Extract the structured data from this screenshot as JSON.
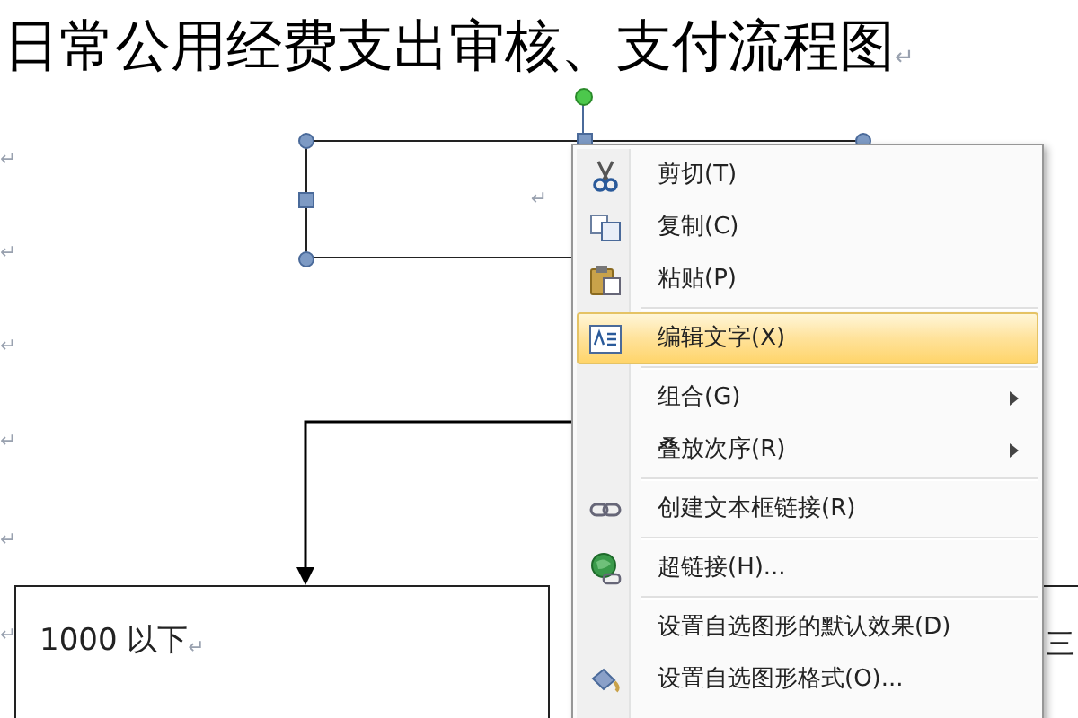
{
  "document": {
    "title": "日常公用经费支出审核、支付流程图",
    "title_mark": "↵",
    "paragraph_marks": [
      "↵",
      "↵",
      "↵",
      "↵",
      "↵",
      "↵"
    ],
    "selected_shape": {
      "mark": "↵"
    },
    "lower_box": {
      "text": "1000 以下",
      "mark": "↵"
    },
    "right_box": {
      "text": "三"
    }
  },
  "context_menu": {
    "items": [
      {
        "kind": "item",
        "label": "剪切(T)",
        "highlighted": false,
        "submenu": false
      },
      {
        "kind": "item",
        "label": "复制(C)",
        "highlighted": false,
        "submenu": false
      },
      {
        "kind": "item",
        "label": "粘贴(P)",
        "highlighted": false,
        "submenu": false
      },
      {
        "kind": "separator"
      },
      {
        "kind": "item",
        "label": "编辑文字(X)",
        "highlighted": true,
        "submenu": false
      },
      {
        "kind": "separator"
      },
      {
        "kind": "item",
        "label": "组合(G)",
        "highlighted": false,
        "submenu": true
      },
      {
        "kind": "item",
        "label": "叠放次序(R)",
        "highlighted": false,
        "submenu": true
      },
      {
        "kind": "separator"
      },
      {
        "kind": "item",
        "label": "创建文本框链接(R)",
        "highlighted": false,
        "submenu": false
      },
      {
        "kind": "separator"
      },
      {
        "kind": "item",
        "label": "超链接(H)...",
        "highlighted": false,
        "submenu": false
      },
      {
        "kind": "separator"
      },
      {
        "kind": "item",
        "label": "设置自选图形的默认效果(D)",
        "highlighted": false,
        "submenu": false
      },
      {
        "kind": "item",
        "label": "设置自选图形格式(O)...",
        "highlighted": false,
        "submenu": false
      }
    ]
  }
}
